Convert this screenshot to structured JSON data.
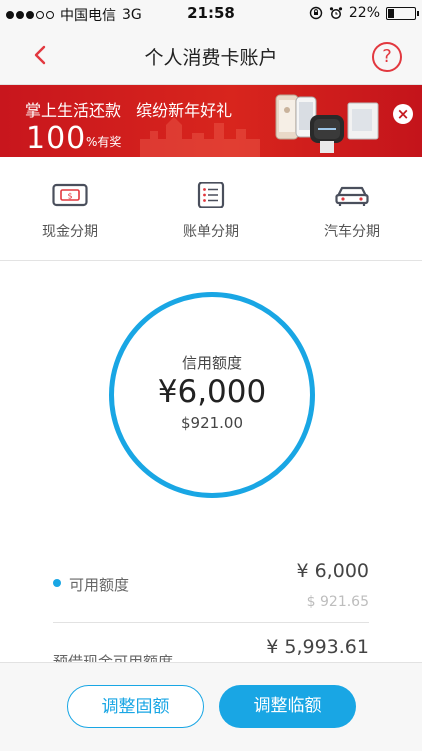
{
  "status_bar": {
    "carrier": "中国电信",
    "network": "3G",
    "time": "21:58",
    "battery_percent": "22%",
    "battery_level": 0.22,
    "signal_dots_filled": 3,
    "signal_dots_total": 5
  },
  "nav": {
    "title": "个人消费卡账户",
    "help_symbol": "?"
  },
  "banner": {
    "headline_part1": "掌上生活还款",
    "headline_part2": "缤纷新年好礼",
    "amount": "100",
    "amount_note": "%有奖",
    "close_symbol": "×"
  },
  "quick_actions": [
    {
      "label": "现金分期",
      "icon": "cash-card-icon"
    },
    {
      "label": "账单分期",
      "icon": "bill-list-icon"
    },
    {
      "label": "汽车分期",
      "icon": "car-icon"
    }
  ],
  "credit": {
    "title": "信用额度",
    "limit": "¥6,000",
    "used": "$921.00"
  },
  "details": {
    "available_label": "可用额度",
    "available_rmb": "¥ 6,000",
    "available_usd": "$ 921.65",
    "cash_label": "预借现金可用额度",
    "cash_rmb": "¥ 5,993.61"
  },
  "actions": {
    "fixed_label": "调整固额",
    "temp_label": "调整临额"
  },
  "colors": {
    "accent": "#19a6e4",
    "brand_red": "#e2383f",
    "banner_red": "#d8251d"
  }
}
